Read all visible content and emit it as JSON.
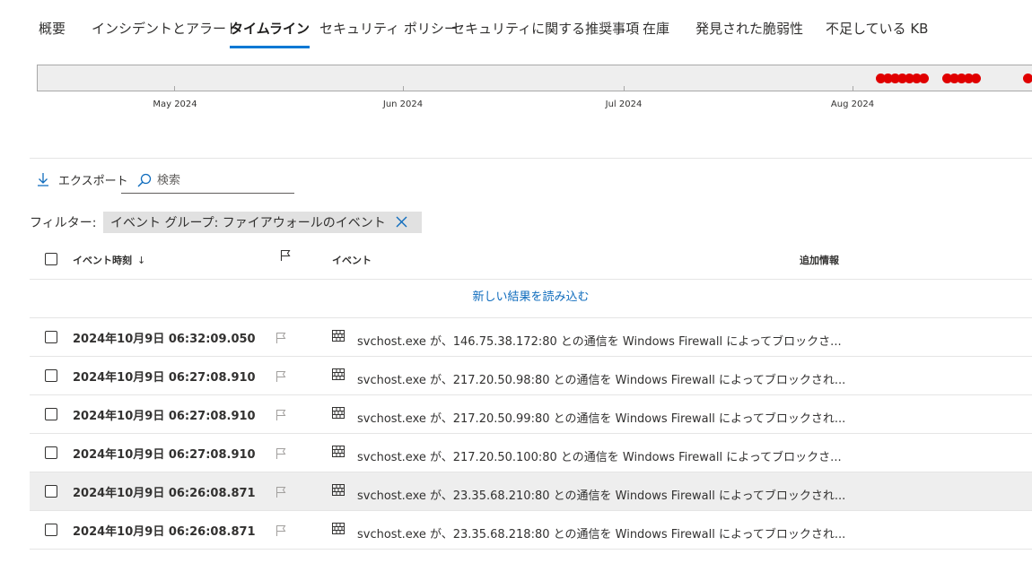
{
  "tabs": [
    {
      "label": "概要",
      "active": false
    },
    {
      "label": "インシデントとアラート",
      "active": false
    },
    {
      "label": "タイムライン",
      "active": true
    },
    {
      "label": "セキュリティ ポリシー",
      "active": false
    },
    {
      "label": "セキュリティに関する推奨事項",
      "active": false
    },
    {
      "label": "在庫",
      "active": false
    },
    {
      "label": "発見された脆弱性",
      "active": false
    },
    {
      "label": "不足している KB",
      "active": false
    }
  ],
  "timeline": {
    "months": [
      "May 2024",
      "Jun 2024",
      "Jul 2024",
      "Aug 2024"
    ],
    "event_marker_color": "#e00000"
  },
  "toolbar": {
    "export_label": "エクスポート",
    "search_placeholder": "検索"
  },
  "filter": {
    "label": "フィルター:",
    "chip_text": "イベント グループ: ファイアウォールのイベント"
  },
  "table": {
    "columns": {
      "time": "イベント時刻",
      "sort_indicator": "↓",
      "event": "イベント",
      "additional_info": "追加情報"
    },
    "load_more": "新しい結果を読み込む",
    "rows": [
      {
        "time": "2024年10月9日 06:32:09.050",
        "event": "svchost.exe が、146.75.38.172:80 との通信を Windows Firewall によってブロックさ..."
      },
      {
        "time": "2024年10月9日 06:27:08.910",
        "event": "svchost.exe が、217.20.50.98:80 との通信を Windows Firewall によってブロックされ..."
      },
      {
        "time": "2024年10月9日 06:27:08.910",
        "event": "svchost.exe が、217.20.50.99:80 との通信を Windows Firewall によってブロックされ..."
      },
      {
        "time": "2024年10月9日 06:27:08.910",
        "event": "svchost.exe が、217.20.50.100:80 との通信を Windows Firewall によってブロックさ..."
      },
      {
        "time": "2024年10月9日 06:26:08.871",
        "event": "svchost.exe が、23.35.68.210:80 との通信を Windows Firewall によってブロックされ..."
      },
      {
        "time": "2024年10月9日 06:26:08.871",
        "event": "svchost.exe が、23.35.68.218:80 との通信を Windows Firewall によってブロックされ..."
      }
    ]
  },
  "colors": {
    "accent": "#0078d4",
    "link": "#0f6cbd",
    "highlight_row": "#eeeeee"
  }
}
